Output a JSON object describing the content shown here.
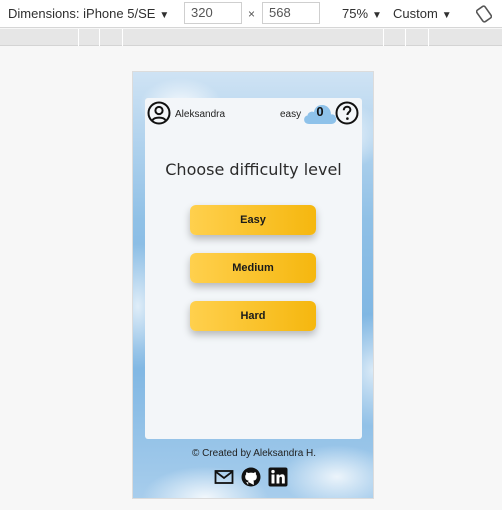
{
  "devtools": {
    "dimensions_label": "Dimensions: iPhone 5/SE",
    "width": "320",
    "height": "568",
    "times": "×",
    "zoom": "75%",
    "throttle": "Custom"
  },
  "app": {
    "username": "Aleksandra",
    "level": "easy",
    "score": "0",
    "title": "Choose difficulty level",
    "buttons": {
      "easy": "Easy",
      "medium": "Medium",
      "hard": "Hard"
    },
    "footer": "© Created by Aleksandra H."
  },
  "icons": {
    "user": "user-circle-icon",
    "help": "question-circle-icon",
    "cloud": "cloud-icon",
    "email": "envelope-icon",
    "github": "github-icon",
    "linkedin": "linkedin-icon",
    "rotate": "rotate-icon"
  },
  "colors": {
    "button_start": "#ffd04d",
    "button_end": "#f5b70f",
    "cloud": "#8ec2ea",
    "card": "#f3f6f9"
  }
}
